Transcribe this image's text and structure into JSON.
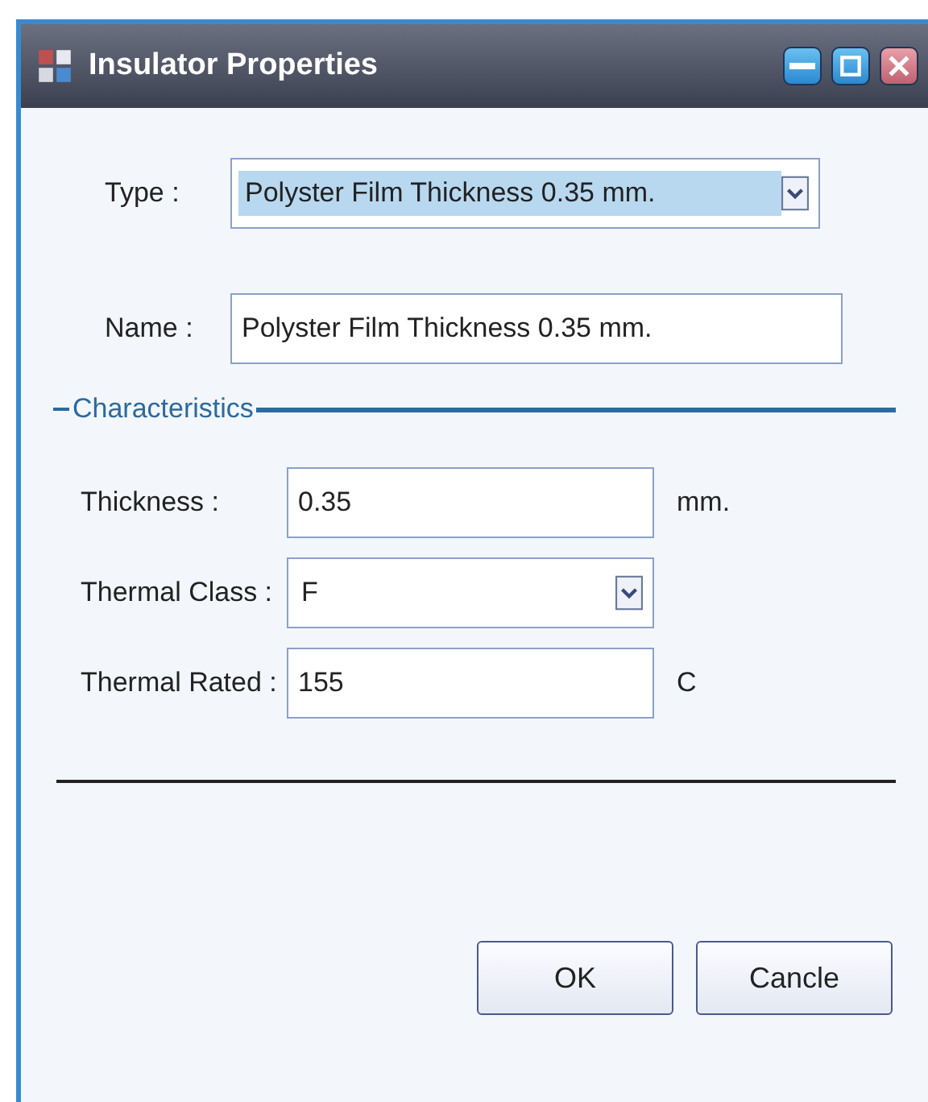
{
  "window": {
    "title": "Insulator Properties"
  },
  "type": {
    "label": "Type :",
    "value": "Polyster Film Thickness 0.35 mm.",
    "highlighted": true
  },
  "name": {
    "label": "Name :",
    "value": "Polyster Film Thickness 0.35 mm."
  },
  "characteristics": {
    "title": "Characteristics",
    "fields": [
      {
        "kind": "text",
        "label": "Thickness :",
        "value": "0.35",
        "unit": "mm."
      },
      {
        "kind": "dropdown",
        "label": "Thermal Class :",
        "value": "F"
      },
      {
        "kind": "text",
        "label": "Thermal Rated :",
        "value": "155",
        "unit": "C"
      }
    ]
  },
  "buttons": [
    "OK",
    "Cancle"
  ]
}
